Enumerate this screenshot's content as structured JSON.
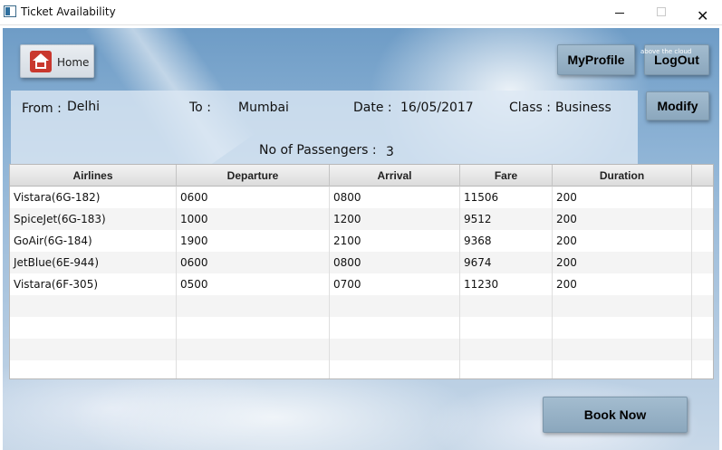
{
  "window": {
    "title": "Ticket Availability",
    "minimize_glyph": "—",
    "maximize_glyph": "☐",
    "close_glyph": "✕"
  },
  "header": {
    "home_label": "Home",
    "myprofile_label": "MyProfile",
    "logout_label": "LogOut",
    "logout_watermark": "above the cloud"
  },
  "search": {
    "from_label": "From :",
    "from_value": "Delhi",
    "to_label": "To :",
    "to_value": "Mumbai",
    "date_label": "Date :",
    "date_value": "16/05/2017",
    "class_label": "Class :",
    "class_value": "Business",
    "passengers_label": "No of Passengers :",
    "passengers_value": "3",
    "modify_label": "Modify"
  },
  "table": {
    "columns": [
      "Airlines",
      "Departure",
      "Arrival",
      "Fare",
      "Duration"
    ],
    "rows": [
      [
        "Vistara(6G-182)",
        "0600",
        "0800",
        "11506",
        "200"
      ],
      [
        "SpiceJet(6G-183)",
        "1000",
        "1200",
        "9512",
        "200"
      ],
      [
        "GoAir(6G-184)",
        "1900",
        "2100",
        "9368",
        "200"
      ],
      [
        "JetBlue(6E-944)",
        "0600",
        "0800",
        "9674",
        "200"
      ],
      [
        "Vistara(6F-305)",
        "0500",
        "0700",
        "11230",
        "200"
      ]
    ]
  },
  "footer": {
    "book_now_label": "Book Now"
  },
  "colors": {
    "button": "#94aec3",
    "panel": "#dce8f4",
    "close_icon": "#111111"
  },
  "icons": {
    "home": "home-icon",
    "app": "window-app-icon"
  }
}
